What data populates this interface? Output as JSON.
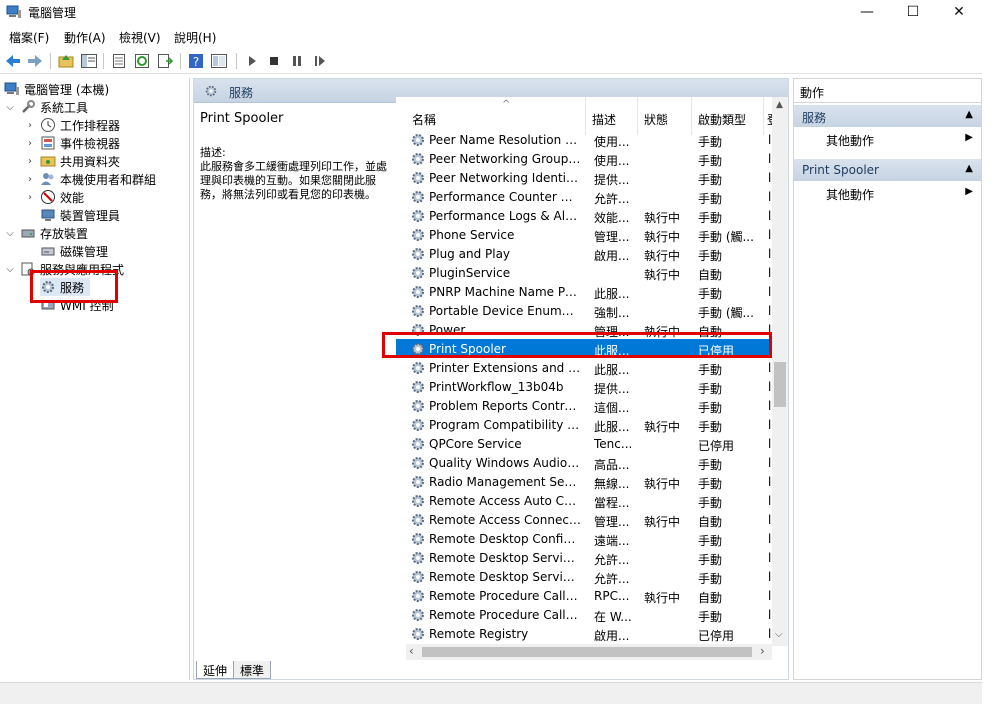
{
  "window": {
    "title": "電腦管理",
    "minimize": "—",
    "maximize": "☐",
    "close": "✕"
  },
  "menu": [
    "檔案(F)",
    "動作(A)",
    "檢視(V)",
    "說明(H)"
  ],
  "tree": {
    "root": "電腦管理 (本機)",
    "system_tools": "系統工具",
    "task_scheduler": "工作排程器",
    "event_viewer": "事件檢視器",
    "shared_folders": "共用資料夾",
    "local_users": "本機使用者和群組",
    "performance": "效能",
    "device_manager": "裝置管理員",
    "storage": "存放裝置",
    "disk_management": "磁碟管理",
    "services_apps": "服務與應用程式",
    "services": "服務",
    "wmi": "WMI 控制"
  },
  "center": {
    "header": "服務",
    "selected_title": "Print Spooler",
    "desc_label": "描述:",
    "desc_body": "此服務會多工緩衝處理列印工作，並處理與印表機的互動。如果您關閉此服務，將無法列印或看見您的印表機。"
  },
  "columns": {
    "name": "名稱",
    "desc": "描述",
    "status": "狀態",
    "startup": "啟動類型",
    "extra": "登"
  },
  "services": [
    {
      "name": "Peer Name Resolution Pr...",
      "desc": "使用...",
      "status": "",
      "startup": "手動"
    },
    {
      "name": "Peer Networking Grouping",
      "desc": "使用...",
      "status": "",
      "startup": "手動"
    },
    {
      "name": "Peer Networking Identity ...",
      "desc": "提供...",
      "status": "",
      "startup": "手動"
    },
    {
      "name": "Performance Counter DLL ...",
      "desc": "允許...",
      "status": "",
      "startup": "手動"
    },
    {
      "name": "Performance Logs & Alerts",
      "desc": "效能...",
      "status": "執行中",
      "startup": "手動"
    },
    {
      "name": "Phone Service",
      "desc": "管理...",
      "status": "執行中",
      "startup": "手動 (觸..."
    },
    {
      "name": "Plug and Play",
      "desc": "啟用...",
      "status": "執行中",
      "startup": "手動"
    },
    {
      "name": "PluginService",
      "desc": "",
      "status": "執行中",
      "startup": "自動"
    },
    {
      "name": "PNRP Machine Name Pub...",
      "desc": "此服...",
      "status": "",
      "startup": "手動"
    },
    {
      "name": "Portable Device Enumerat...",
      "desc": "強制...",
      "status": "",
      "startup": "手動 (觸..."
    },
    {
      "name": "Power",
      "desc": "管理...",
      "status": "執行中",
      "startup": "自動"
    },
    {
      "name": "Print Spooler",
      "desc": "此服...",
      "status": "",
      "startup": "已停用",
      "selected": true
    },
    {
      "name": "Printer Extensions and No...",
      "desc": "此服...",
      "status": "",
      "startup": "手動"
    },
    {
      "name": "PrintWorkflow_13b04b",
      "desc": "提供...",
      "status": "",
      "startup": "手動"
    },
    {
      "name": "Problem Reports Control ...",
      "desc": "這個...",
      "status": "",
      "startup": "手動"
    },
    {
      "name": "Program Compatibility As...",
      "desc": "此服...",
      "status": "執行中",
      "startup": "手動"
    },
    {
      "name": "QPCore Service",
      "desc": "Tenc...",
      "status": "",
      "startup": "已停用"
    },
    {
      "name": "Quality Windows Audio Vi...",
      "desc": "高品...",
      "status": "",
      "startup": "手動"
    },
    {
      "name": "Radio Management Servi...",
      "desc": "無線...",
      "status": "執行中",
      "startup": "手動"
    },
    {
      "name": "Remote Access Auto Con...",
      "desc": "當程...",
      "status": "",
      "startup": "手動"
    },
    {
      "name": "Remote Access Connectio...",
      "desc": "管理...",
      "status": "執行中",
      "startup": "自動"
    },
    {
      "name": "Remote Desktop Configur...",
      "desc": "遠端...",
      "status": "",
      "startup": "手動"
    },
    {
      "name": "Remote Desktop Services",
      "desc": "允許...",
      "status": "",
      "startup": "手動"
    },
    {
      "name": "Remote Desktop Services ...",
      "desc": "允許...",
      "status": "",
      "startup": "手動"
    },
    {
      "name": "Remote Procedure Call (R...",
      "desc": "RPC...",
      "status": "執行中",
      "startup": "自動"
    },
    {
      "name": "Remote Procedure Call (R...",
      "desc": "在 W...",
      "status": "",
      "startup": "手動"
    },
    {
      "name": "Remote Registry",
      "desc": "啟用...",
      "status": "",
      "startup": "已停用"
    }
  ],
  "tabs": {
    "extended": "延伸",
    "standard": "標準"
  },
  "actions": {
    "title": "動作",
    "section1": "服務",
    "more1": "其他動作",
    "section2": "Print Spooler",
    "more2": "其他動作"
  },
  "colors": {
    "selection": "#0078d7",
    "highlight_box": "#e00000"
  }
}
